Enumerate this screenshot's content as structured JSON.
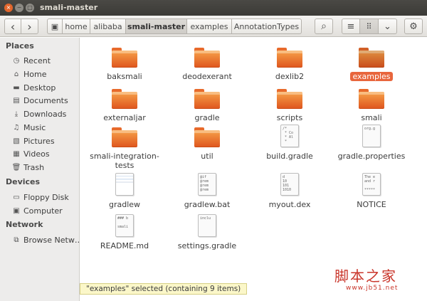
{
  "window": {
    "title": "smali-master",
    "close_glyph": "×",
    "min_glyph": "−",
    "max_glyph": "□"
  },
  "toolbar": {
    "back_glyph": "‹",
    "forward_glyph": "›",
    "location_glyph": "▣",
    "breadcrumbs": [
      "home",
      "alibaba",
      "smali-master",
      "examples",
      "AnnotationTypes"
    ],
    "active_crumb": "smali-master",
    "search_glyph": "⌕",
    "list_glyph": "≡",
    "grid_glyph": "⠿",
    "dropdown_glyph": "⌄",
    "settings_glyph": "⚙"
  },
  "sidebar": {
    "places_title": "Places",
    "places": [
      {
        "label": "Recent",
        "icon": "clock-icon",
        "glyph": "◷"
      },
      {
        "label": "Home",
        "icon": "home-icon",
        "glyph": "⌂"
      },
      {
        "label": "Desktop",
        "icon": "desktop-icon",
        "glyph": "▬"
      },
      {
        "label": "Documents",
        "icon": "documents-icon",
        "glyph": "▤"
      },
      {
        "label": "Downloads",
        "icon": "downloads-icon",
        "glyph": "⤓"
      },
      {
        "label": "Music",
        "icon": "music-icon",
        "glyph": "♫"
      },
      {
        "label": "Pictures",
        "icon": "pictures-icon",
        "glyph": "▧"
      },
      {
        "label": "Videos",
        "icon": "videos-icon",
        "glyph": "▦"
      },
      {
        "label": "Trash",
        "icon": "trash-icon",
        "glyph": "🗑"
      }
    ],
    "devices_title": "Devices",
    "devices": [
      {
        "label": "Floppy Disk",
        "icon": "floppy-icon",
        "glyph": "▭"
      },
      {
        "label": "Computer",
        "icon": "computer-icon",
        "glyph": "▣"
      }
    ],
    "network_title": "Network",
    "network": [
      {
        "label": "Browse Netw…",
        "icon": "network-icon",
        "glyph": "⧉"
      }
    ]
  },
  "files": [
    {
      "name": "baksmali",
      "type": "folder"
    },
    {
      "name": "deodexerant",
      "type": "folder"
    },
    {
      "name": "dexlib2",
      "type": "folder"
    },
    {
      "name": "examples",
      "type": "folder",
      "selected": true
    },
    {
      "name": "externaljar",
      "type": "folder"
    },
    {
      "name": "gradle",
      "type": "folder"
    },
    {
      "name": "scripts",
      "type": "folder"
    },
    {
      "name": "smali",
      "type": "folder"
    },
    {
      "name": "smali-integration-tests",
      "type": "folder"
    },
    {
      "name": "util",
      "type": "folder"
    },
    {
      "name": "build.gradle",
      "type": "text",
      "preview": "/*\n * Co\n * Al\n *"
    },
    {
      "name": "gradle.properties",
      "type": "text",
      "preview": "org.g"
    },
    {
      "name": "gradlew",
      "type": "image",
      "preview": ""
    },
    {
      "name": "gradlew.bat",
      "type": "text",
      "preview": "@if\n@rem\n@rem\n@rem"
    },
    {
      "name": "myout.dex",
      "type": "text",
      "preview": "d\n10\n101\n1010"
    },
    {
      "name": "NOTICE",
      "type": "text",
      "preview": "The e\nand r\n\n*****"
    },
    {
      "name": "README.md",
      "type": "text",
      "preview": "### b\n\nsmali"
    },
    {
      "name": "settings.gradle",
      "type": "text",
      "preview": "inclu"
    }
  ],
  "status": {
    "text": "\"examples\" selected (containing 9 items)"
  },
  "watermark": {
    "text": "脚本之家",
    "sub": "www.jb51.net"
  }
}
